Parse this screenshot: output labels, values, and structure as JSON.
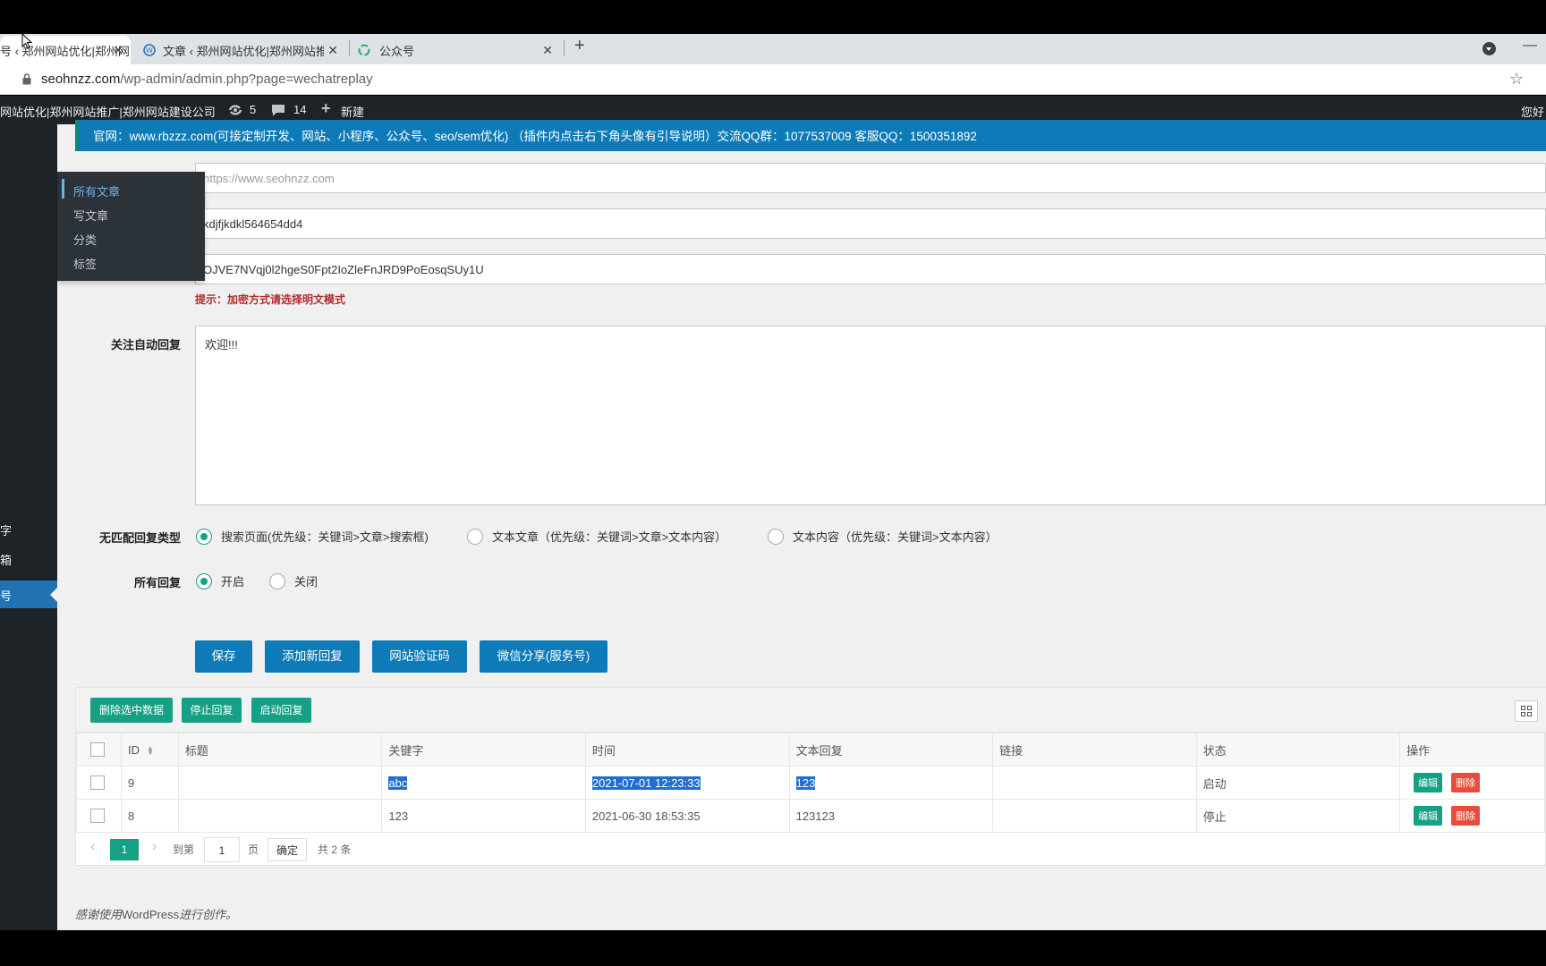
{
  "browser": {
    "tabs": [
      {
        "title": "号 ‹ 郑州网站优化|郑州网",
        "active": true
      },
      {
        "title": "文章 ‹ 郑州网站优化|郑州网站推",
        "active": false
      },
      {
        "title": "公众号",
        "active": false
      }
    ],
    "close_glyph": "✕",
    "new_tab_glyph": "+",
    "minimize_glyph": "—",
    "url_host": "seohnzz.com",
    "url_path": "/wp-admin/admin.php?page=wechatreplay",
    "star_glyph": "☆"
  },
  "adminbar": {
    "site_name": "网站优化|郑州网站推广|郑州网站建设公司",
    "updates_count": "5",
    "comments_count": "14",
    "new_label": "新建",
    "greeting": "您好"
  },
  "sidebar": {
    "active_label": "号",
    "item_keywords": "字",
    "item_mailbox": "箱"
  },
  "flyout": {
    "items": [
      "所有文章",
      "写文章",
      "分类",
      "标签"
    ]
  },
  "banner": {
    "text": "官网：www.rbzzz.com(可接定制开发、网站、小程序、公众号、seo/sem优化) （插件内点击右下角头像有引导说明）交流QQ群：1077537009 客服QQ：1500351892"
  },
  "form": {
    "url_placeholder": "https://www.seohnzz.com",
    "token_value": "kdjfjkdkl564654dd4",
    "aeskey_value": "OJVE7NVqj0l2hgeS0Fpt2IoZleFnJRD9PoEosqSUy1U",
    "hint": "提示：加密方式请选择明文模式",
    "follow_reply_label": "关注自动回复",
    "follow_reply_value": "欢迎!!!",
    "nomatch_label": "无匹配回复类型",
    "nomatch_options": [
      "搜索页面(优先级：关键词>文章>搜索框)",
      "文本文章（优先级：关键词>文章>文本内容）",
      "文本内容（优先级：关键词>文本内容）"
    ],
    "all_reply_label": "所有回复",
    "all_reply_options": [
      "开启",
      "关闭"
    ]
  },
  "actions": {
    "save": "保存",
    "add_reply": "添加新回复",
    "site_verify": "网站验证码",
    "wechat_share": "微信分享(服务号)"
  },
  "table": {
    "toolbar": {
      "delete_selected": "删除选中数据",
      "stop_reply": "停止回复",
      "start_reply": "启动回复"
    },
    "columns": [
      "ID",
      "标题",
      "关键字",
      "时间",
      "文本回复",
      "链接",
      "状态",
      "操作"
    ],
    "rows": [
      {
        "id": "9",
        "title": "",
        "keyword": "abc",
        "time": "2021-07-01 12:23:33",
        "text_reply": "123",
        "link": "",
        "status": "启动",
        "edit": "编辑",
        "delete": "删除"
      },
      {
        "id": "8",
        "title": "",
        "keyword": "123",
        "time": "2021-06-30 18:53:35",
        "text_reply": "123123",
        "link": "",
        "status": "停止",
        "edit": "编辑",
        "delete": "删除"
      }
    ],
    "pager": {
      "prev": "‹",
      "current": "1",
      "next": "›",
      "goto_label": "到第",
      "page_input": "1",
      "page_label": "页",
      "confirm": "确定",
      "total": "共 2 条"
    }
  },
  "footer": {
    "text_before": "感谢使用",
    "brand": "WordPress",
    "text_after": "进行创作。"
  }
}
